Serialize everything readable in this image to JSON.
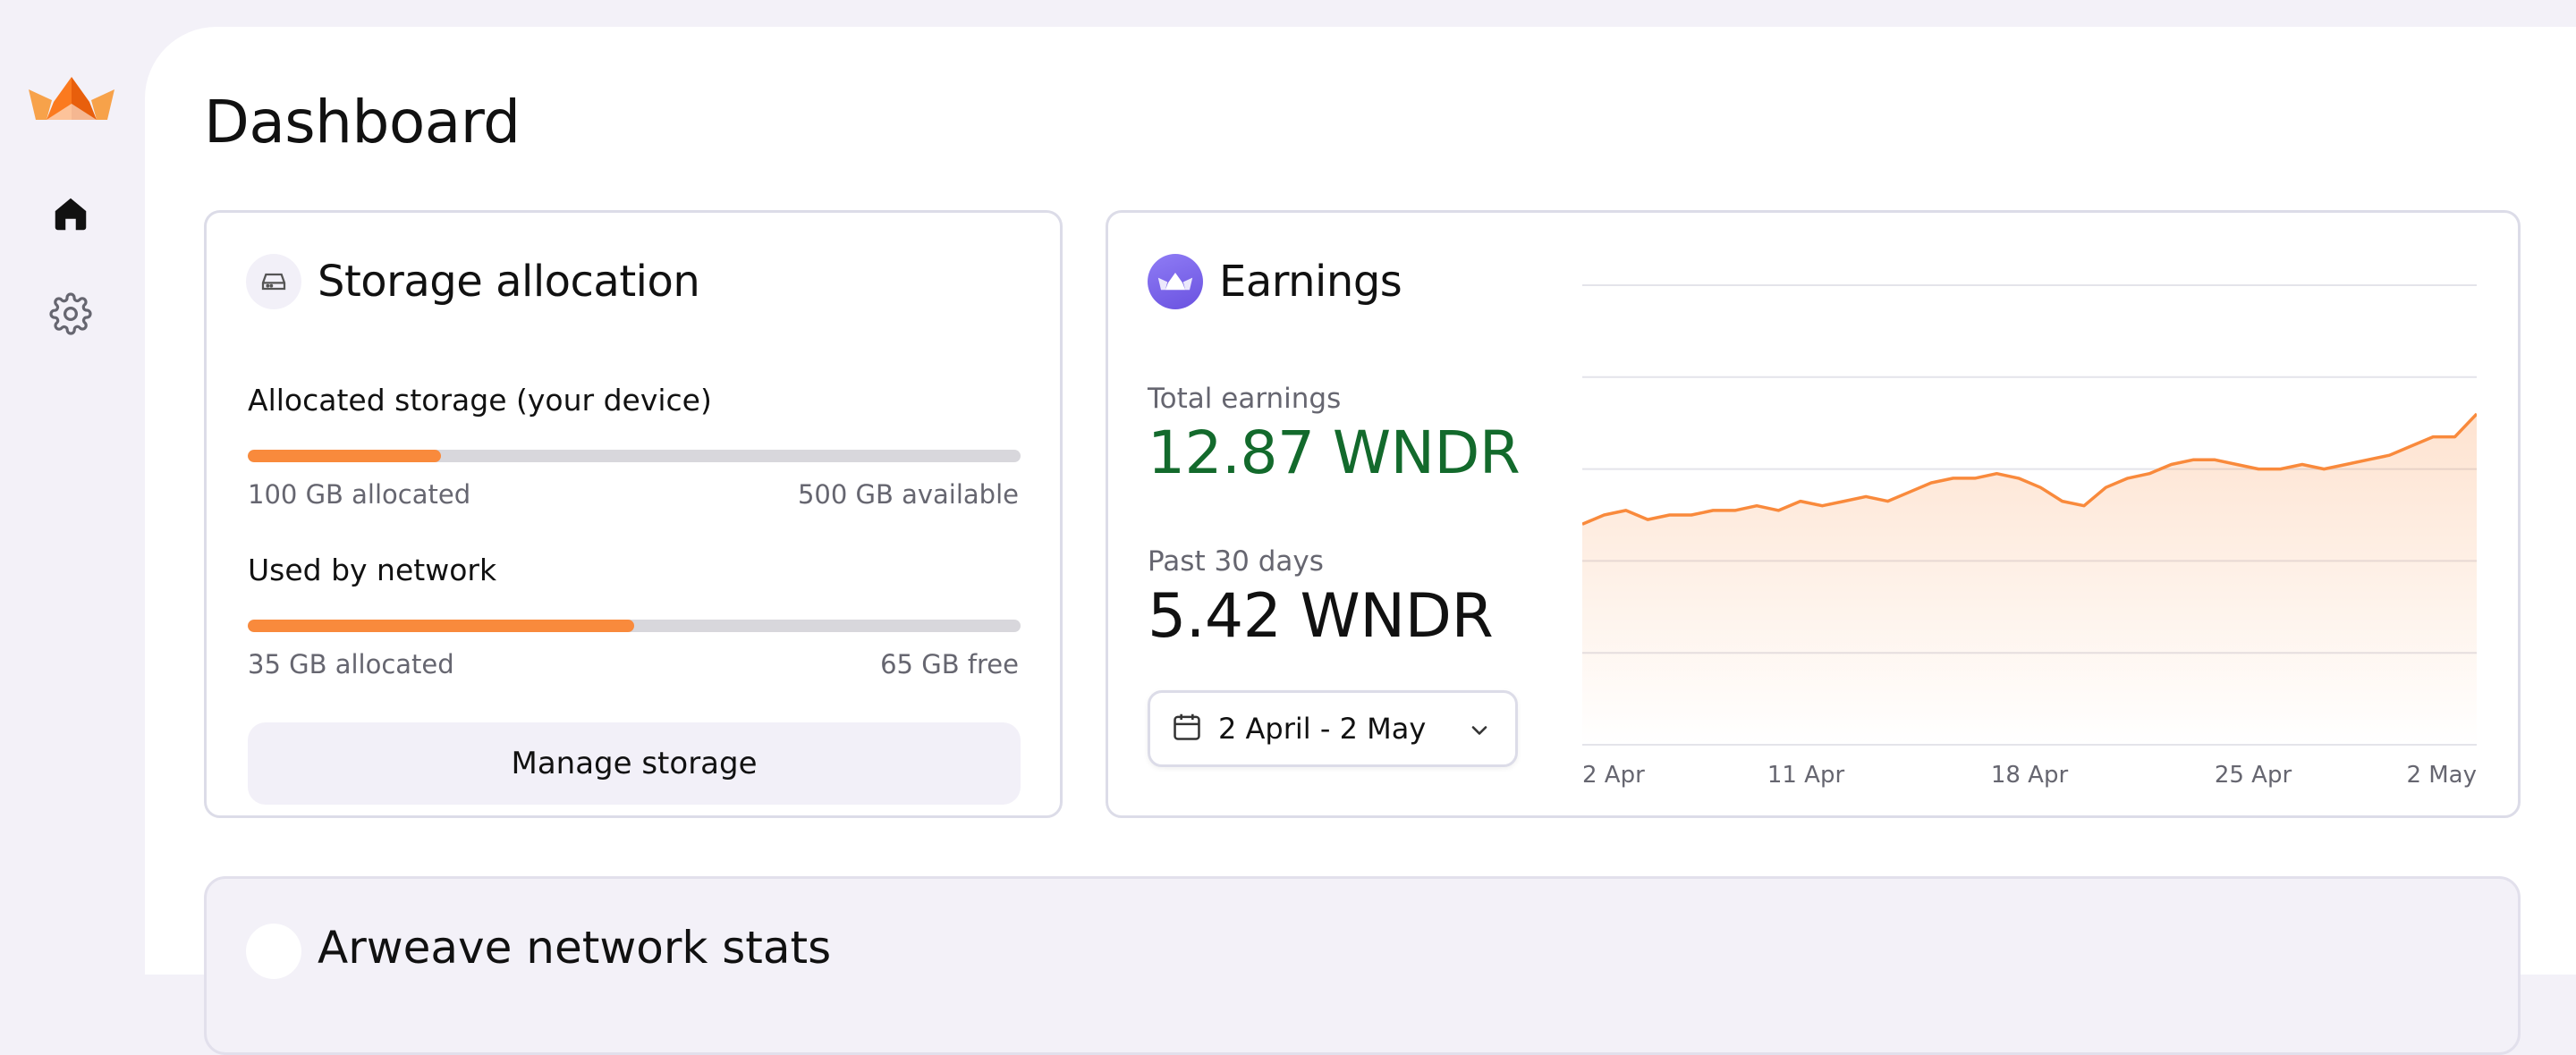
{
  "page": {
    "title": "Dashboard"
  },
  "sidebar": {
    "logo": "crown-logo",
    "items": [
      {
        "icon": "home-icon",
        "active": true
      },
      {
        "icon": "gear-icon",
        "active": false
      }
    ]
  },
  "storage": {
    "title": "Storage allocation",
    "icon": "hard-drive-icon",
    "allocated": {
      "label": "Allocated storage (your device)",
      "fill": 0.25,
      "left_note": "100 GB allocated",
      "right_note": "500 GB available"
    },
    "network": {
      "label": "Used by network",
      "fill": 0.5,
      "left_note": "35 GB allocated",
      "right_note": "65 GB free"
    },
    "manage_label": "Manage storage"
  },
  "earnings": {
    "title": "Earnings",
    "icon": "crown-icon",
    "total_label": "Total earnings",
    "total_value": "12.87 WNDR",
    "past_label": "Past 30 days",
    "past_value": "5.42 WNDR",
    "date_range": "2 April - 2 May"
  },
  "network_stats": {
    "title": "Arweave network stats",
    "icon": "globe-icon"
  },
  "colors": {
    "accent": "#f98a3c",
    "green": "#136a2c",
    "purple": "#7a66ee",
    "track": "#d8d7dc"
  },
  "chart_data": {
    "type": "area",
    "x_ticks": [
      "2 Apr",
      "11 Apr",
      "18 Apr",
      "25 Apr",
      "2 May"
    ],
    "ylim": [
      0,
      1
    ],
    "grid": true,
    "values": [
      0.48,
      0.5,
      0.51,
      0.49,
      0.5,
      0.5,
      0.51,
      0.51,
      0.52,
      0.51,
      0.53,
      0.52,
      0.53,
      0.54,
      0.53,
      0.55,
      0.57,
      0.58,
      0.58,
      0.59,
      0.58,
      0.56,
      0.53,
      0.52,
      0.56,
      0.58,
      0.59,
      0.61,
      0.62,
      0.62,
      0.61,
      0.6,
      0.6,
      0.61,
      0.6,
      0.61,
      0.62,
      0.63,
      0.65,
      0.67,
      0.67,
      0.72
    ]
  }
}
